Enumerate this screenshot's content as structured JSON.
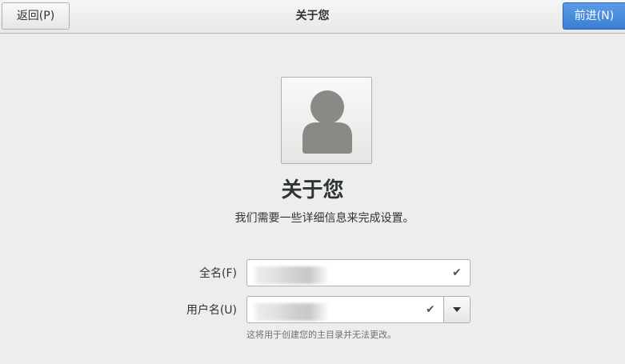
{
  "header": {
    "back_label": "返回(P)",
    "title": "关于您",
    "next_label": "前进(N)"
  },
  "main": {
    "avatar_icon": "user-avatar-icon",
    "heading": "关于您",
    "subtitle": "我们需要一些详细信息来完成设置。"
  },
  "form": {
    "fullname_label": "全名(F)",
    "fullname_value": "",
    "username_label": "用户名(U)",
    "username_value": "",
    "check_glyph": "✔",
    "username_hint": "这将用于创建您的主目录并无法更改。"
  },
  "colors": {
    "accent": "#3a7fd4",
    "background": "#ededed"
  }
}
